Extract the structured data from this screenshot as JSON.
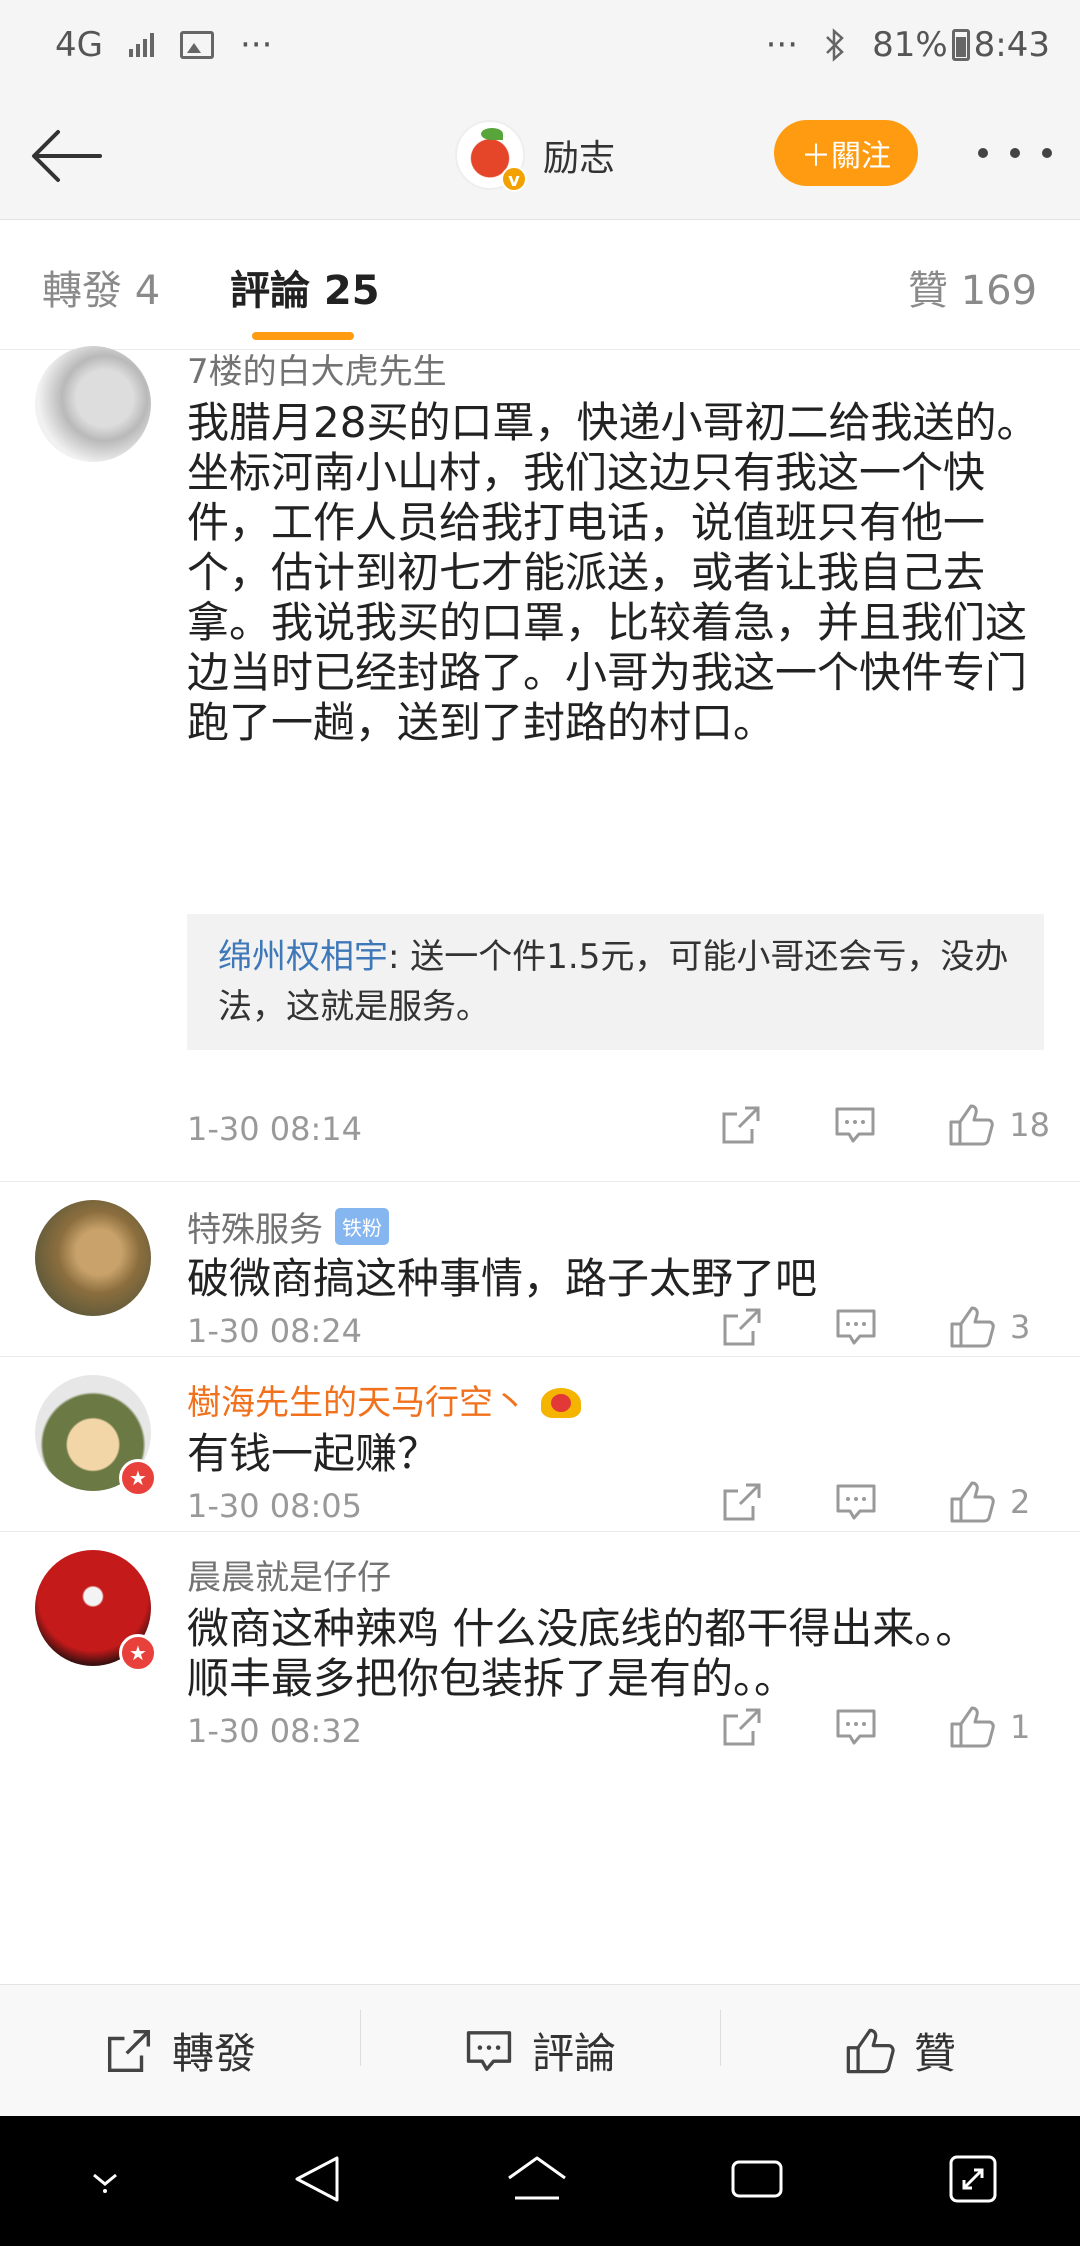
{
  "status_bar": {
    "network": "4G",
    "overflow": "···",
    "overflow_right": "···",
    "battery": "81%",
    "time": "8:43"
  },
  "header": {
    "account_name": "励志",
    "follow_label": "＋關注"
  },
  "tabs": [
    {
      "label": "轉發 4"
    },
    {
      "label": "評論 25"
    },
    {
      "label": "贊 169"
    }
  ],
  "comments": [
    {
      "user": "7楼的白大虎先生",
      "text": "我腊月28买的口罩，快递小哥初二给我送的。坐标河南小山村，我们这边只有我这一个快件，工作人员给我打电话，说值班只有他一个，估计到初七才能派送，或者让我自己去拿。我说我买的口罩，比较着急，并且我们这边当时已经封路了。小哥为我这一个快件专门跑了一趟，送到了封路的村口。",
      "reply_user": "绵州权相宇",
      "reply_text": ": 送一个件1.5元，可能小哥还会亏，没办法，这就是服务。",
      "time": "1-30 08:14",
      "likes": "18"
    },
    {
      "user": "特殊服务",
      "badge": "铁粉",
      "text": "破微商搞这种事情，路子太野了吧",
      "time": "1-30 08:24",
      "likes": "3"
    },
    {
      "user": "樹海先生的天马行空丶",
      "text": "有钱一起赚？",
      "time": "1-30 08:05",
      "likes": "2"
    },
    {
      "user": "晨晨就是仔仔",
      "text": "微商这种辣鸡 什么没底线的都干得出来。。顺丰最多把你包装拆了是有的。。",
      "time": "1-30 08:32",
      "likes": "1"
    }
  ],
  "bottom_bar": {
    "repost": "轉發",
    "comment": "評論",
    "like": "贊"
  },
  "colors": {
    "accent": "#ff9b11",
    "link": "#3f78b9",
    "vip_name": "#f1711d",
    "fan_badge": "#86b6f0"
  }
}
